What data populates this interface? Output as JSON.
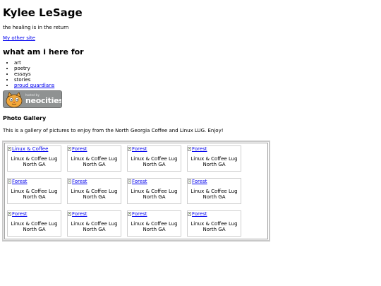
{
  "header": {
    "title": "Kylee LeSage",
    "tagline": "the healing is in the return",
    "other_site_link": "My other site"
  },
  "section": {
    "heading": "what am i here for",
    "items": [
      {
        "label": "art",
        "is_link": false
      },
      {
        "label": "poetry",
        "is_link": false
      },
      {
        "label": "essays",
        "is_link": false
      },
      {
        "label": "stories",
        "is_link": false
      },
      {
        "label": "proud guardians",
        "is_link": true
      }
    ]
  },
  "badge": {
    "small_text": "hosted by",
    "big_text": "neocities"
  },
  "gallery": {
    "heading": "Photo Gallery",
    "intro": "This is a gallery of pictures to enjoy from the North Georgia Coffee and Linux LUG. Enjoy!",
    "rows": [
      [
        {
          "alt": "Linux & Coffee",
          "caption": "Linux & Coffee Lug North GA"
        },
        {
          "alt": "Forest",
          "caption": "Linux & Coffee Lug North GA"
        },
        {
          "alt": "Forest",
          "caption": "Linux & Coffee Lug North GA"
        },
        {
          "alt": "Forest",
          "caption": "Linux & Coffee Lug North GA"
        }
      ],
      [
        {
          "alt": "Forest",
          "caption": "Linux & Coffee Lug North GA"
        },
        {
          "alt": "Forest",
          "caption": "Linux & Coffee Lug North GA"
        },
        {
          "alt": "Forest",
          "caption": "Linux & Coffee Lug North GA"
        },
        {
          "alt": "Forest",
          "caption": "Linux & Coffee Lug North GA"
        }
      ],
      [
        {
          "alt": "Forest",
          "caption": "Linux & Coffee Lug North GA"
        },
        {
          "alt": "Forest",
          "caption": "Linux & Coffee Lug North GA"
        },
        {
          "alt": "Forest",
          "caption": "Linux & Coffee Lug North GA"
        },
        {
          "alt": "Forest",
          "caption": "Linux & Coffee Lug North GA"
        }
      ]
    ]
  },
  "colors": {
    "link": "#0000ee",
    "badge_background": "#8f9292"
  }
}
